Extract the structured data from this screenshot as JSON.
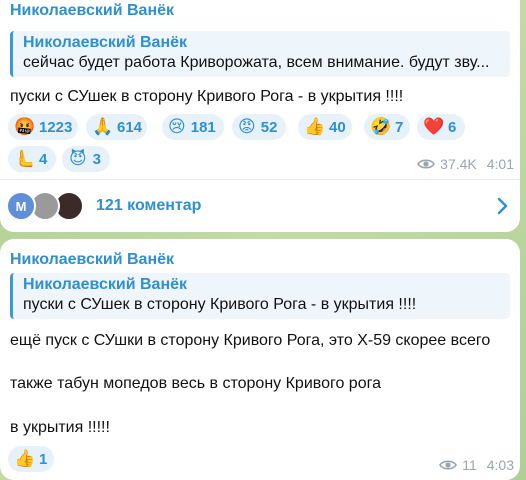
{
  "post1": {
    "sender": "Николаевский Ванёк",
    "reply_name": "Николаевский Ванёк",
    "reply_text": "сейчас будет работа Криворожата, всем внимание. будут зву...",
    "text": "пуски с СУшек в сторону Кривого Рога - в укрытия !!!!",
    "reactions": [
      {
        "emoji": "🤬",
        "count": "1223"
      },
      {
        "emoji": "🙏",
        "count": "614"
      },
      {
        "emoji": "😢",
        "count": "181"
      },
      {
        "emoji": "😡",
        "count": "52"
      },
      {
        "emoji": "👍",
        "count": "40"
      },
      {
        "emoji": "🤣",
        "count": "7"
      },
      {
        "emoji": "❤️",
        "count": "6"
      },
      {
        "emoji": "🫷",
        "count": "4"
      },
      {
        "emoji": "😈",
        "count": "3"
      }
    ],
    "views": "37.4K",
    "time": "4:01",
    "comments_label": "121 коментар",
    "avatar_letter": "M"
  },
  "post2": {
    "sender": "Николаевский Ванёк",
    "reply_name": "Николаевский Ванёк",
    "reply_text": "пуски с СУшек в сторону Кривого Рога - в укрытия !!!!",
    "line1": "ещё пуск с СУшки в сторону Кривого Рога, это Х-59 скорее всего",
    "line2": "также табун мопедов весь в сторону Кривого рога",
    "line3": "в укрытия !!!!!",
    "reactions": [
      {
        "emoji": "👍",
        "count": "1"
      }
    ],
    "views": "11",
    "time": "4:03"
  },
  "colors": {
    "accent": "#2f8fcf",
    "reaction_bg": "#e6f1fa",
    "chat_bg": "#b6d29e"
  }
}
